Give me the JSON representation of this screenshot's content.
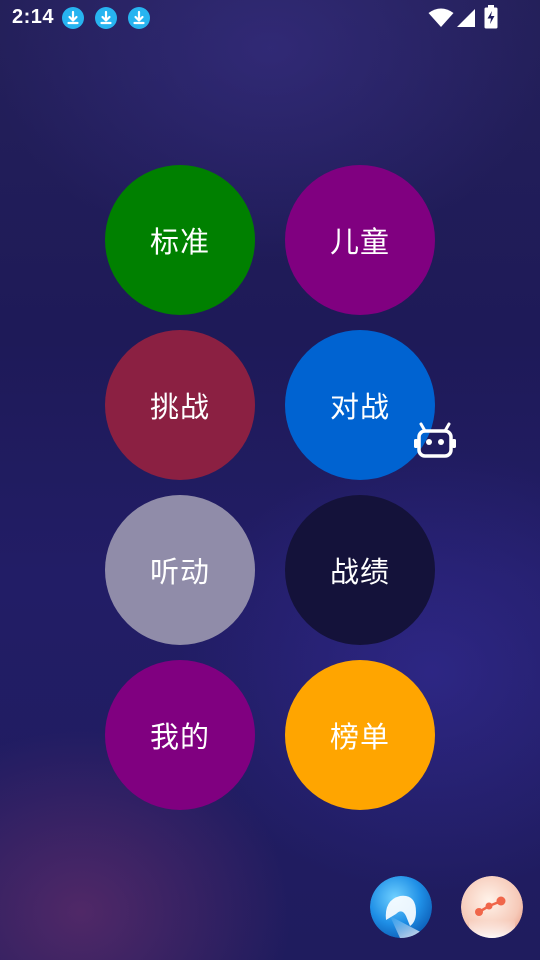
{
  "status_bar": {
    "time": "2:14",
    "notification_icons": [
      "download-icon",
      "download-icon",
      "download-icon"
    ],
    "right_icons": [
      "wifi-icon",
      "signal-icon",
      "battery-charging-icon"
    ]
  },
  "menu": {
    "buttons": [
      {
        "label": "标准",
        "color": "#008000"
      },
      {
        "label": "儿童",
        "color": "#800080"
      },
      {
        "label": "挑战",
        "color": "#8b2042"
      },
      {
        "label": "对战",
        "color": "#0063d1"
      },
      {
        "label": "听动",
        "color": "#908ca9"
      },
      {
        "label": "战绩",
        "color": "#14123a"
      },
      {
        "label": "我的",
        "color": "#800080"
      },
      {
        "label": "榜单",
        "color": "#ffa500"
      }
    ]
  },
  "floating": {
    "robot_icon": "robot-icon",
    "left_fab_icon": "blob-icon",
    "right_fab_icon": "share-node-icon"
  }
}
